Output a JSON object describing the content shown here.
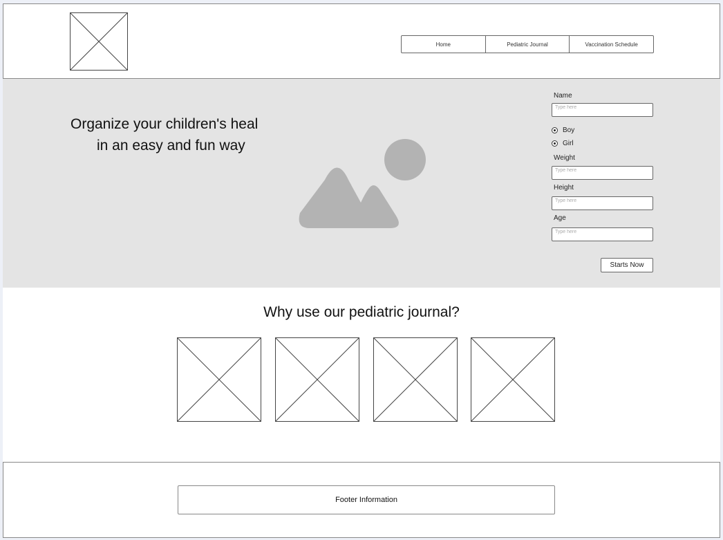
{
  "header": {
    "logo_icon": "image-placeholder-icon",
    "nav": [
      "Home",
      "Pediatric Journal",
      "Vaccination Schedule"
    ]
  },
  "hero": {
    "title_line1": "Organize your children's heal",
    "title_line2": "in an easy and fun way",
    "image_icon": "landscape-image-icon"
  },
  "form": {
    "name_label": "Name",
    "name_placeholder": "Type here",
    "gender_options": [
      "Boy",
      "Girl"
    ],
    "weight_label": "Weight",
    "weight_placeholder": "Type here",
    "height_label": "Height",
    "height_placeholder": "Type here",
    "age_label": "Age",
    "age_placeholder": "Type here",
    "submit_label": "Starts Now"
  },
  "features": {
    "title": "Why use our pediatric journal?",
    "items": [
      "image-placeholder-icon",
      "image-placeholder-icon",
      "image-placeholder-icon",
      "image-placeholder-icon"
    ]
  },
  "footer": {
    "label": "Footer Information"
  },
  "colors": {
    "page_bg": "#edf0f7",
    "hero_bg": "#e4e4e4",
    "image_gray": "#b3b3b3",
    "border": "#666666"
  }
}
